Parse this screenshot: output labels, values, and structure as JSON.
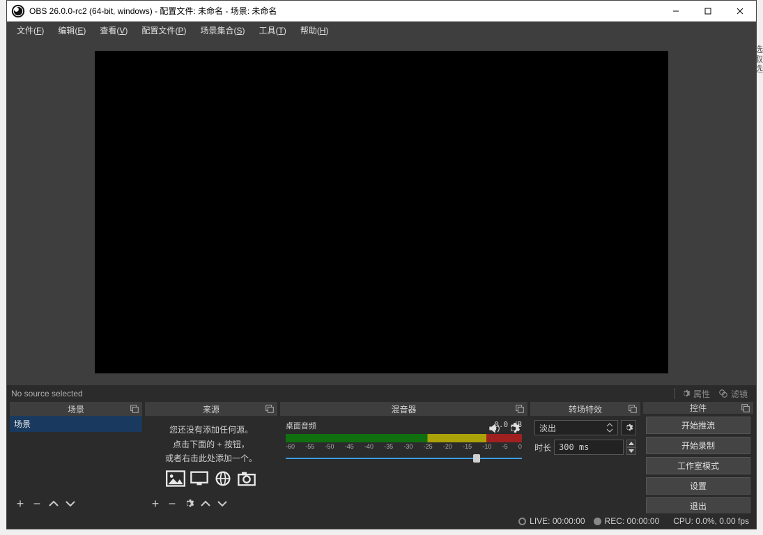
{
  "window": {
    "title": "OBS 26.0.0-rc2 (64-bit, windows) - 配置文件: 未命名 - 场景: 未命名",
    "minimize": "–",
    "close": "×"
  },
  "menubar": {
    "file": "文件",
    "file_u": "F",
    "edit": "编辑",
    "edit_u": "E",
    "view": "查看",
    "view_u": "V",
    "profiles": "配置文件",
    "profiles_u": "P",
    "scene_collection": "场景集合",
    "scene_collection_u": "S",
    "tools": "工具",
    "tools_u": "T",
    "help": "帮助",
    "help_u": "H"
  },
  "mid": {
    "no_source": "No source selected",
    "properties": "属性",
    "filters": "滤镜"
  },
  "docks": {
    "scenes": {
      "title": "场景",
      "item0": "场景"
    },
    "sources": {
      "title": "来源",
      "empty1": "您还没有添加任何源。",
      "empty2": "点击下面的 + 按钮，",
      "empty3": "或者右击此处添加一个。"
    },
    "mixer": {
      "title": "混音器",
      "track_name": "桌面音频",
      "db": "0.0 dB",
      "ticks": [
        "-60",
        "-55",
        "-50",
        "-45",
        "-40",
        "-35",
        "-30",
        "-25",
        "-20",
        "-15",
        "-10",
        "-5",
        "0"
      ]
    },
    "transitions": {
      "title": "转场特效",
      "select_value": "淡出",
      "duration_label": "时长",
      "duration_value": "300 ms"
    },
    "controls": {
      "title": "控件",
      "start_stream": "开始推流",
      "start_record": "开始录制",
      "studio_mode": "工作室模式",
      "settings": "设置",
      "exit": "退出"
    }
  },
  "status": {
    "live": "LIVE: 00:00:00",
    "rec": "REC: 00:00:00",
    "cpu": "CPU: 0.0%, 0.00 fps"
  }
}
